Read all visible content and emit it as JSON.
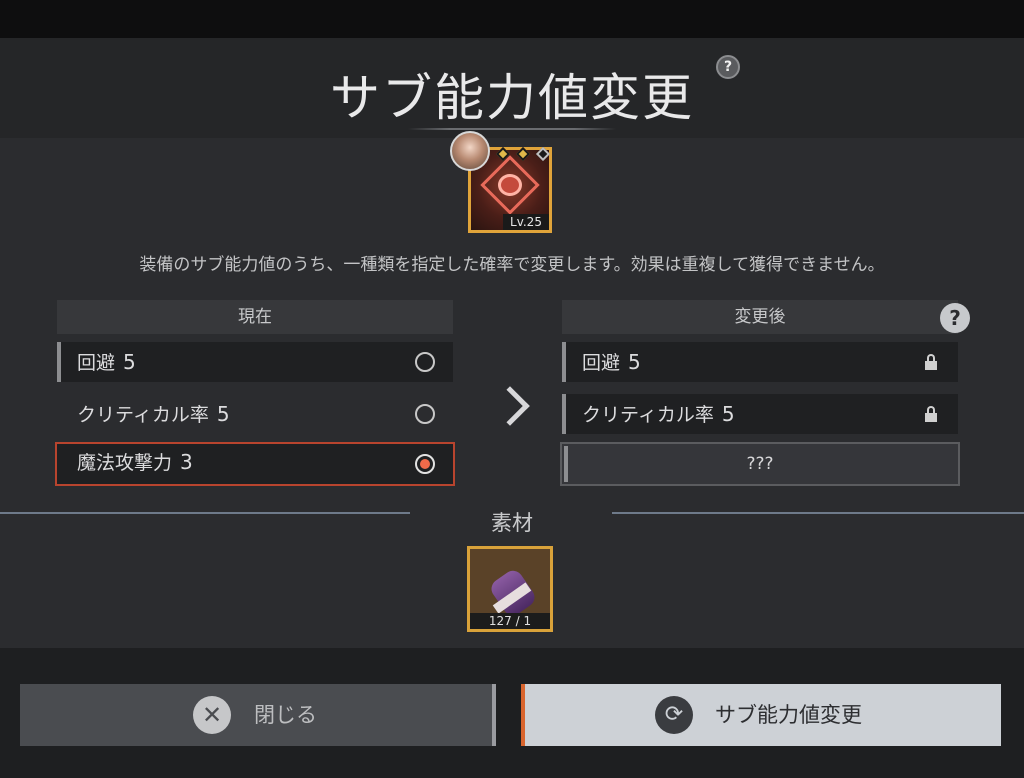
{
  "title": "サブ能力値変更",
  "help_glyph": "?",
  "equipment": {
    "level": "Lv.25",
    "gem_colors": [
      "#e0b84a",
      "#e0b84a",
      "#1a1a1a"
    ]
  },
  "description": "装備のサブ能力値のうち、一種類を指定した確率で変更します。効果は重複して獲得できません。",
  "current": {
    "header": "現在",
    "rows": [
      {
        "label": "回避",
        "value": "5",
        "selected": false
      },
      {
        "label": "クリティカル率",
        "value": "5",
        "selected": false
      },
      {
        "label": "魔法攻撃力",
        "value": "3",
        "selected": true
      }
    ]
  },
  "after": {
    "header": "変更後",
    "rows": [
      {
        "label": "回避",
        "value": "5",
        "icon": "lock-icon"
      },
      {
        "label": "クリティカル率",
        "value": "5",
        "icon": "lock-icon"
      }
    ],
    "unknown": "???"
  },
  "materials": {
    "label": "素材",
    "item_count": "127 / 1",
    "icon": "potion-bottle-icon"
  },
  "buttons": {
    "close_label": "閉じる",
    "close_icon": "✕",
    "change_label": "サブ能力値変更",
    "change_icon": "⟳"
  },
  "colors": {
    "accent_orange": "#d9652e",
    "gold_frame": "#e0a43a",
    "selected_border": "#b8442e"
  }
}
